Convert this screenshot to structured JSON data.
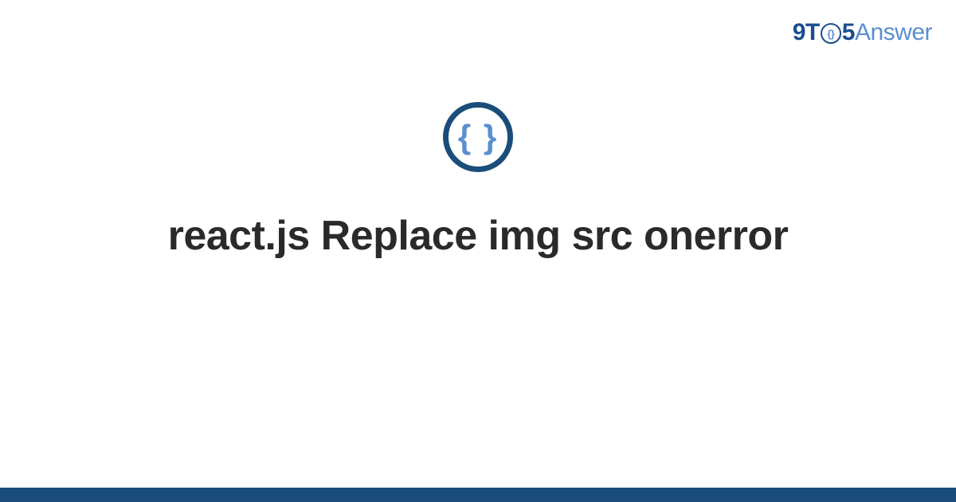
{
  "logo": {
    "part1": "9T",
    "circle_inner": "{}",
    "part2": "5",
    "part3": "Answer"
  },
  "icon": {
    "name": "curly-braces-icon",
    "glyph": "{ }"
  },
  "title": "react.js Replace img src onerror",
  "colors": {
    "dark_blue": "#1a4d7a",
    "medium_blue": "#1a4d8f",
    "light_blue": "#5a8fd0"
  }
}
